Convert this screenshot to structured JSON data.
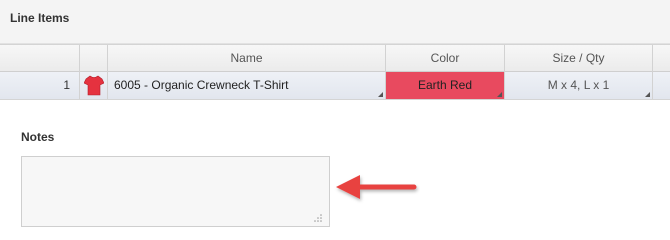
{
  "panel": {
    "title": "Line Items"
  },
  "grid": {
    "columns": {
      "name": "Name",
      "color": "Color",
      "size_qty": "Size / Qty"
    },
    "rows": [
      {
        "num": "1",
        "icon": "tshirt-icon",
        "name": "6005 - Organic Crewneck T-Shirt",
        "color": "Earth Red",
        "size_qty": "M x 4, L x 1"
      }
    ]
  },
  "notes": {
    "label": "Notes",
    "value": ""
  },
  "colors": {
    "swatch_earth_red": "#e84a5f",
    "arrow": "#e8423f",
    "row_bg": "#e6eaf1"
  },
  "annotation": {
    "icon": "arrow-left-icon"
  }
}
